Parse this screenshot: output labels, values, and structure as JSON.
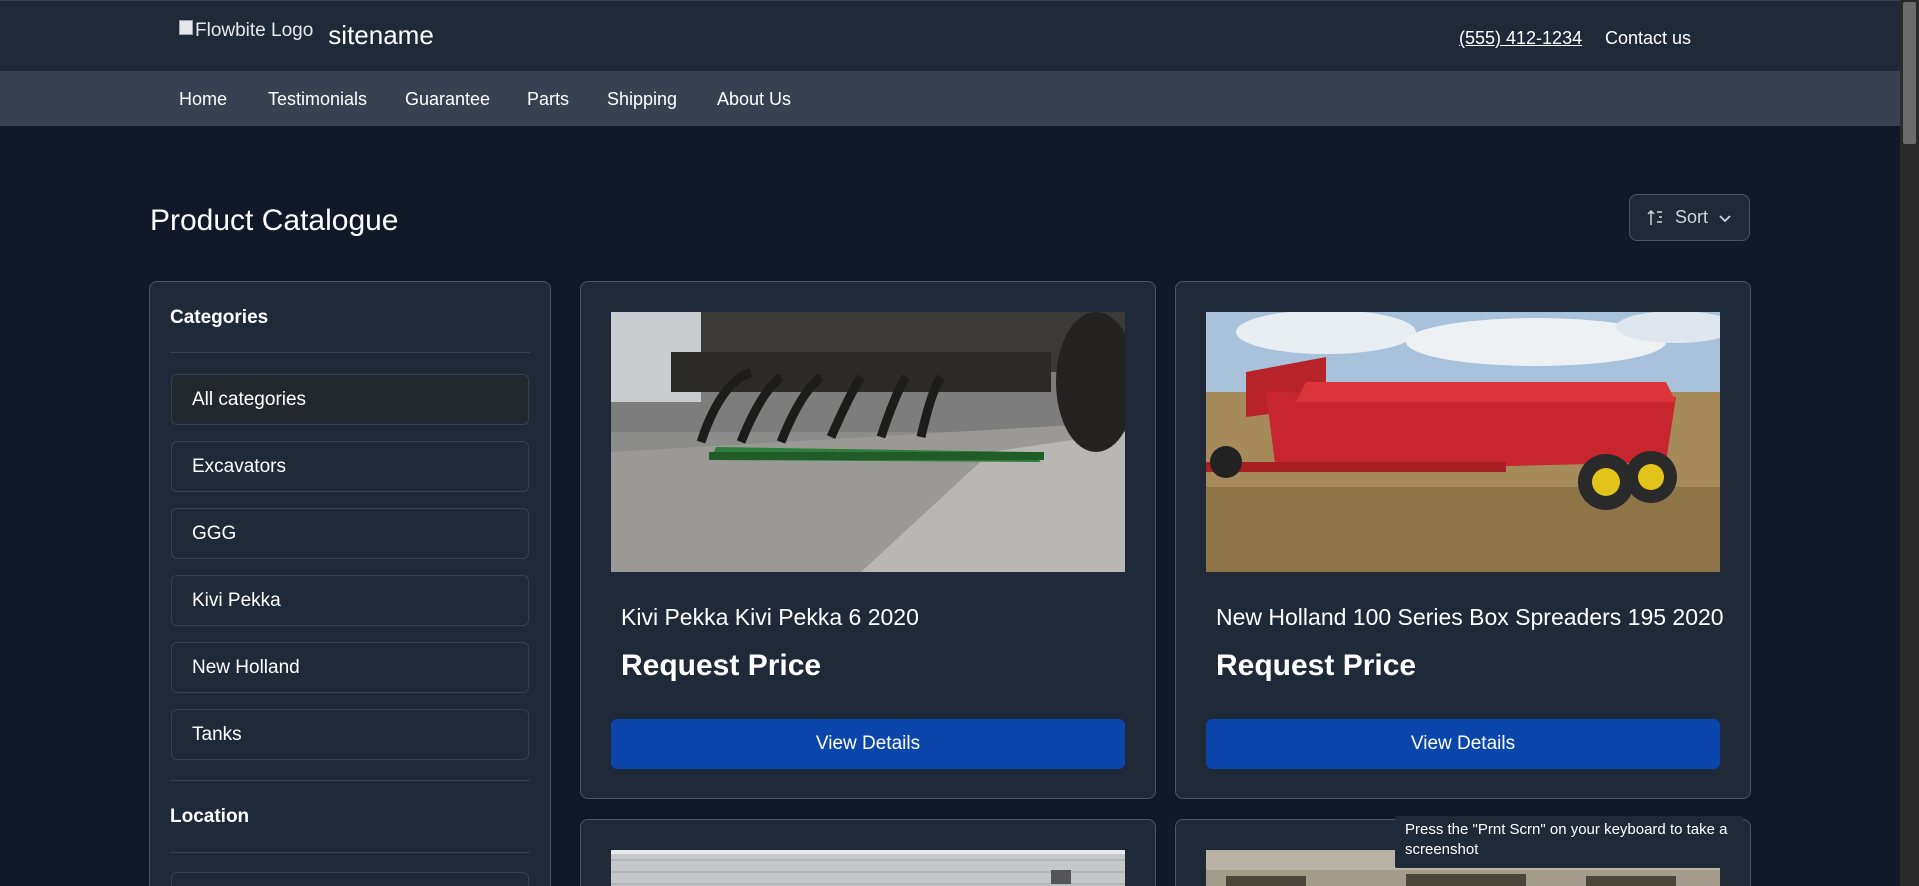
{
  "header": {
    "logo_alt": "Flowbite Logo",
    "sitename": "sitename",
    "phone": "(555) 412-1234",
    "contact": "Contact us"
  },
  "nav": {
    "items": [
      "Home",
      "Testimonials",
      "Guarantee",
      "Parts",
      "Shipping",
      "About Us"
    ]
  },
  "main": {
    "title": "Product Catalogue",
    "sort_label": "Sort"
  },
  "sidebar": {
    "categories_heading": "Categories",
    "categories": [
      "All categories",
      "Excavators",
      "GGG",
      "Kivi Pekka",
      "New Holland",
      "Tanks"
    ],
    "location_heading": "Location"
  },
  "products": [
    {
      "title": "Kivi Pekka Kivi Pekka 6 2020",
      "price": "Request Price",
      "button": "View Details"
    },
    {
      "title": "New Holland 100 Series Box Spreaders 195 2020",
      "price": "Request Price",
      "button": "View Details"
    }
  ],
  "tooltip": {
    "text": "Press the \"Prnt Scrn\" on your keyboard to take a screenshot"
  },
  "colors": {
    "page_bg": "#111827",
    "header_bg": "#1f2937",
    "nav_bg": "#374151",
    "button_blue": "#0b46ac"
  }
}
